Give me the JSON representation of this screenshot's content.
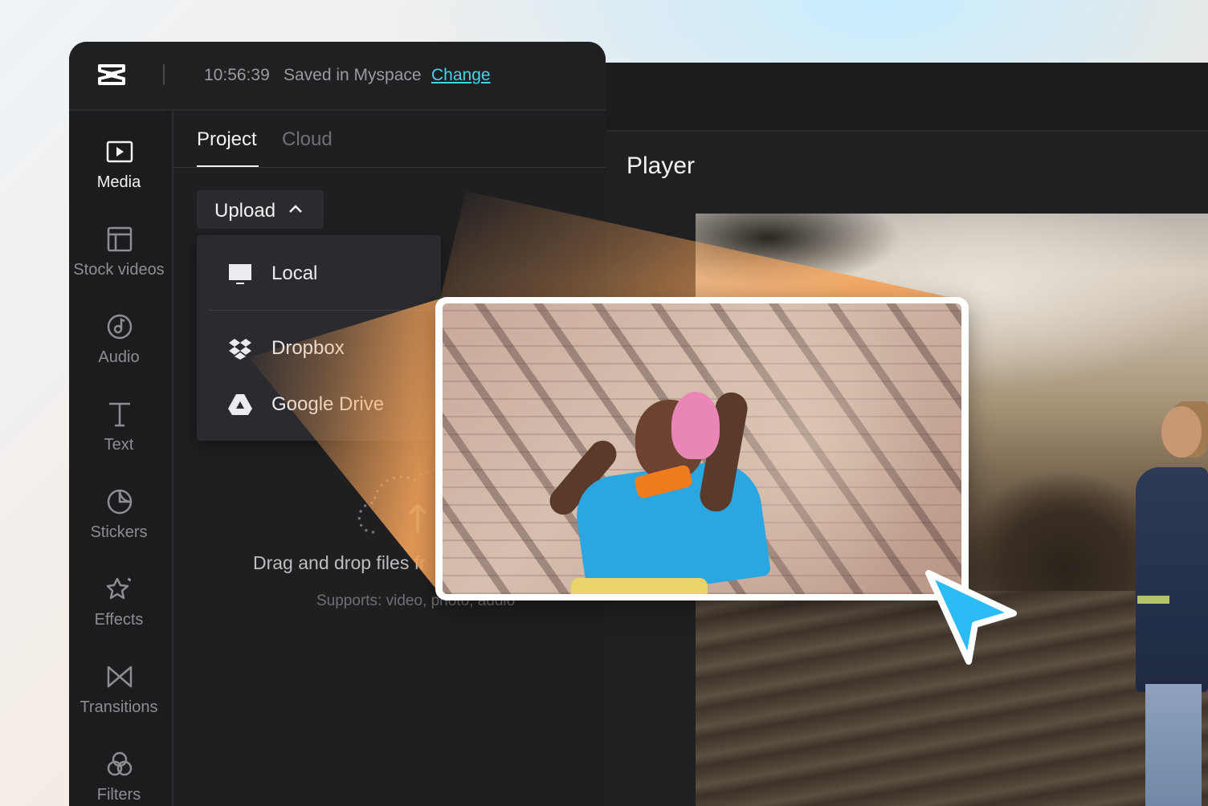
{
  "colors": {
    "accent_link": "#3fd6e6",
    "cursor_blue": "#2bbbf5",
    "beam_orange": "#f4a35a",
    "panel_dark": "#1f1f22"
  },
  "topbar": {
    "logo_icon": "capcut-logo-icon",
    "save_time": "10:56:39",
    "save_location": "Saved in Myspace",
    "change_link": "Change"
  },
  "sidebar": {
    "items": [
      {
        "label": "Media",
        "icon": "media-icon",
        "active": true
      },
      {
        "label": "Stock videos",
        "icon": "stock-videos-icon",
        "active": false
      },
      {
        "label": "Audio",
        "icon": "audio-icon",
        "active": false
      },
      {
        "label": "Text",
        "icon": "text-icon",
        "active": false
      },
      {
        "label": "Stickers",
        "icon": "stickers-icon",
        "active": false
      },
      {
        "label": "Effects",
        "icon": "effects-icon",
        "active": false
      },
      {
        "label": "Transitions",
        "icon": "transitions-icon",
        "active": false
      },
      {
        "label": "Filters",
        "icon": "filters-icon",
        "active": false
      }
    ]
  },
  "tabs": {
    "project": "Project",
    "cloud": "Cloud"
  },
  "upload": {
    "button_label": "Upload",
    "menu": [
      {
        "label": "Local",
        "icon": "monitor-icon"
      },
      {
        "label": "Dropbox",
        "icon": "dropbox-icon"
      },
      {
        "label": "Google Drive",
        "icon": "google-drive-icon"
      }
    ]
  },
  "dropzone": {
    "title": "Drag and drop files fr",
    "subtitle": "Supports: video, photo, audio"
  },
  "player": {
    "title": "Player"
  }
}
